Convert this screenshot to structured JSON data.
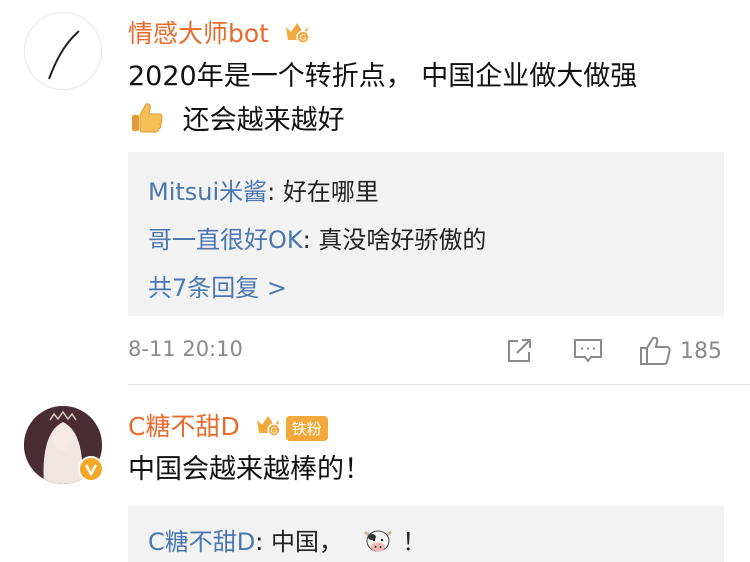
{
  "comments": [
    {
      "username": "情感大师bot",
      "text_line1": "2020年是一个转折点，  中国企业做大做强",
      "text_line2": "还会越来越好",
      "replies": [
        {
          "user": "Mitsui米酱",
          "text": "好在哪里"
        },
        {
          "user": "哥一直很好OK",
          "text": "真没啥好骄傲的"
        }
      ],
      "more_replies": "共7条回复 >",
      "timestamp": "8-11 20:10",
      "like_count": "185",
      "icons": [
        "share-icon",
        "comment-icon",
        "like-icon",
        "crown-badge-icon",
        "thumbs-up-emoji"
      ]
    },
    {
      "username": "C糖不甜D",
      "fan_badge": "铁粉",
      "text": "中国会越来越棒的！",
      "replies": [
        {
          "user": "C糖不甜D",
          "text": "中国，",
          "suffix": "！"
        }
      ],
      "icons": [
        "crown-badge-icon",
        "cow-emoji",
        "verified-icon"
      ]
    }
  ],
  "colors": {
    "username": "#e86a2c",
    "reply_user": "#4a77b0",
    "meta": "#8a8a8a",
    "reply_bg": "#f2f2f2"
  }
}
